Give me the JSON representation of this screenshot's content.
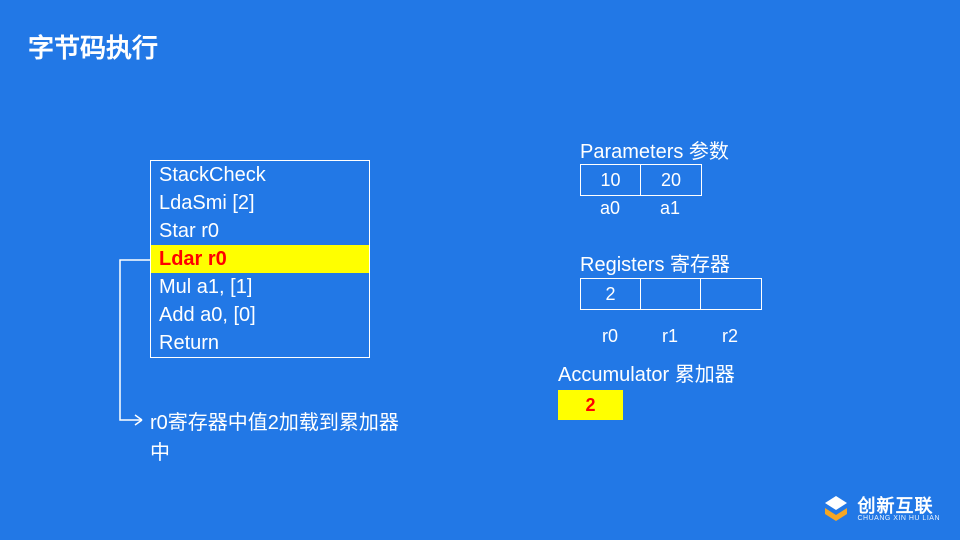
{
  "title": "字节码执行",
  "bytecode": {
    "lines": [
      "StackCheck",
      "LdaSmi [2]",
      "Star r0",
      "Ldar r0",
      "Mul a1, [1]",
      "Add a0, [0]",
      "Return"
    ],
    "highlight_index": 3
  },
  "explain": "r0寄存器中值2加载到累加器中",
  "parameters": {
    "label": "Parameters 参数",
    "values": [
      "10",
      "20"
    ],
    "names": [
      "a0",
      "a1"
    ]
  },
  "registers": {
    "label": "Registers 寄存器",
    "values": [
      "2",
      "",
      ""
    ],
    "names": [
      "r0",
      "r1",
      "r2"
    ]
  },
  "accumulator": {
    "label": "Accumulator 累加器",
    "value": "2"
  },
  "logo": {
    "brand": "创新互联",
    "sub": "CHUANG XIN HU LIAN"
  }
}
